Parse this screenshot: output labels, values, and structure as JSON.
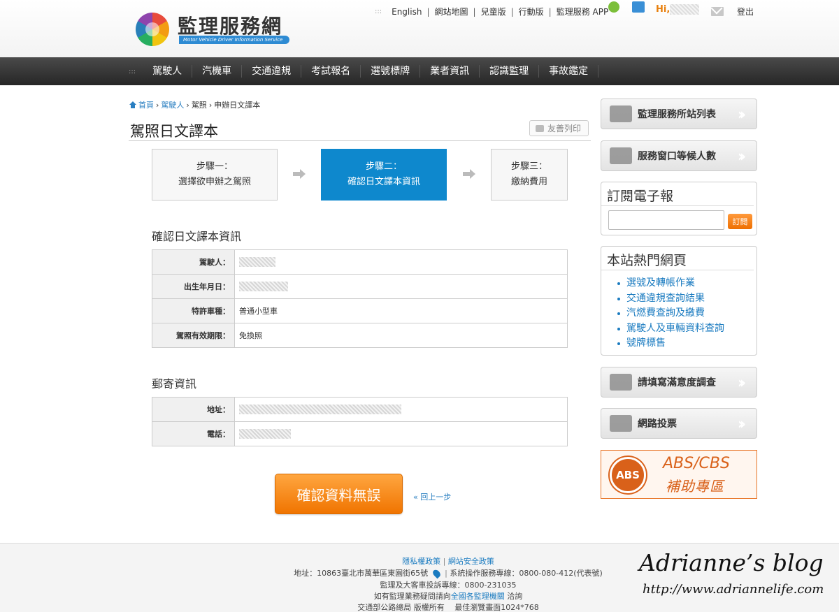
{
  "header": {
    "logo_text": "監理服務網",
    "logo_sub": "Motor Vehicle Driver Information Service",
    "toplinks": [
      "English",
      "網站地圖",
      "兒童版",
      "行動版",
      "監理服務 APP"
    ],
    "dots": ":::",
    "greeting": "Hi,",
    "logout": "登出"
  },
  "nav": {
    "dots": ":::",
    "items": [
      "駕駛人",
      "汽機車",
      "交通違規",
      "考試報名",
      "選號標牌",
      "業者資訊",
      "認識監理",
      "事故鑑定"
    ]
  },
  "breadcrumb": {
    "home": "首頁",
    "driver": "駕駛人",
    "license": "駕照",
    "current": "申辦日文譯本",
    "sep": "›"
  },
  "page_title": "駕照日文譯本",
  "print_label": "友善列印",
  "steps": [
    {
      "line1": "步驟一：",
      "line2": "選擇欲申辦之駕照"
    },
    {
      "line1": "步驟二：",
      "line2": "確認日文譯本資訊"
    },
    {
      "line1": "步驟三：",
      "line2": "繳納費用"
    }
  ],
  "confirm_section": {
    "title": "確認日文譯本資訊",
    "rows": [
      {
        "label": "駕駛人：",
        "value": ""
      },
      {
        "label": "出生年月日：",
        "value": ""
      },
      {
        "label": "特許車種：",
        "value": "普通小型車"
      },
      {
        "label": "駕照有效期限：",
        "value": "免換照"
      }
    ]
  },
  "mail_section": {
    "title": "郵寄資訊",
    "rows": [
      {
        "label": "地址：",
        "value": ""
      },
      {
        "label": "電話：",
        "value": ""
      }
    ]
  },
  "confirm_button": "確認資料無誤",
  "back_link": "« 回上一步",
  "sidebar": {
    "station_list": "監理服務所站列表",
    "queue": "服務窗口等候人數",
    "subscribe_title": "訂閱電子報",
    "subscribe_button": "訂閱",
    "hot_title": "本站熱門網頁",
    "hot_links": [
      "選號及轉帳作業",
      "交通違規查詢結果",
      "汽燃費查詢及繳費",
      "駕駛人及車輛資料查詢",
      "號牌標售"
    ],
    "survey": "請填寫滿意度調查",
    "vote": "網路投票",
    "abs_badge": "ABS",
    "abs_title": "ABS/CBS",
    "abs_sub": "補助專區"
  },
  "footer": {
    "privacy": "隱私權政策",
    "security": "網站安全政策",
    "address": "地址：10863臺北市萬華區東園街65號",
    "hotline": "系統操作服務專線：0800-080-412(代表號)",
    "complaint": "監理及大客車投訴專線：0800-231035",
    "inquiry_pre": "如有監理業務疑問請向",
    "inquiry_link": "全國各監理機關",
    "inquiry_post": " 洽詢",
    "copyright": "交通部公路總局 版權所有　 最佳瀏覽畫面1024*768"
  },
  "watermark": {
    "title": "Adrianne’s blog",
    "url": "http://www.adriannelife.com"
  },
  "colors": {
    "step_active": "#0e88cd",
    "link": "#1a7bc0",
    "orange": "#f07400",
    "nav_bg": "#2e2e2e"
  }
}
